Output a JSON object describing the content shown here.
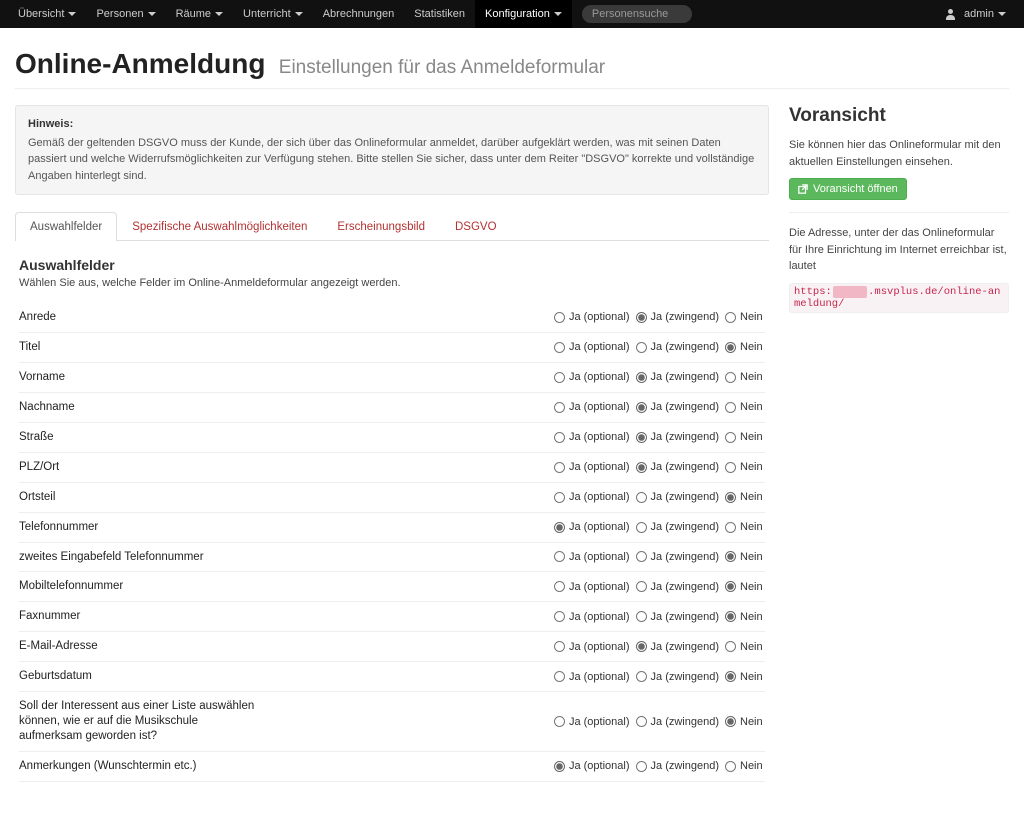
{
  "navbar": {
    "items": [
      {
        "label": "Übersicht",
        "caret": true
      },
      {
        "label": "Personen",
        "caret": true
      },
      {
        "label": "Räume",
        "caret": true
      },
      {
        "label": "Unterricht",
        "caret": true
      },
      {
        "label": "Abrechnungen",
        "caret": false
      },
      {
        "label": "Statistiken",
        "caret": false
      },
      {
        "label": "Konfiguration",
        "caret": true,
        "active": true
      }
    ],
    "search_placeholder": "Personensuche",
    "user_label": "admin"
  },
  "page": {
    "title": "Online-Anmeldung",
    "subtitle": "Einstellungen für das Anmeldeformular"
  },
  "hint": {
    "heading": "Hinweis:",
    "body": "Gemäß der geltenden DSGVO muss der Kunde, der sich über das Onlineformular anmeldet, darüber aufgeklärt werden, was mit seinen Daten passiert und welche Widerrufsmöglichkeiten zur Verfügung stehen. Bitte stellen Sie sicher, dass unter dem Reiter \"DSGVO\" korrekte und vollständige Angaben hinterlegt sind."
  },
  "tabs": [
    {
      "label": "Auswahlfelder",
      "active": true
    },
    {
      "label": "Spezifische Auswahlmöglichkeiten"
    },
    {
      "label": "Erscheinungsbild"
    },
    {
      "label": "DSGVO"
    }
  ],
  "section": {
    "title": "Auswahlfelder",
    "desc": "Wählen Sie aus, welche Felder im Online-Anmeldeformular angezeigt werden."
  },
  "option_labels": {
    "optional": "Ja (optional)",
    "required": "Ja (zwingend)",
    "no": "Nein"
  },
  "fields": [
    {
      "label": "Anrede",
      "selected": "required"
    },
    {
      "label": "Titel",
      "selected": "no"
    },
    {
      "label": "Vorname",
      "selected": "required"
    },
    {
      "label": "Nachname",
      "selected": "required"
    },
    {
      "label": "Straße",
      "selected": "required"
    },
    {
      "label": "PLZ/Ort",
      "selected": "required"
    },
    {
      "label": "Ortsteil",
      "selected": "no"
    },
    {
      "label": "Telefonnummer",
      "selected": "optional"
    },
    {
      "label": "zweites Eingabefeld Telefonnummer",
      "selected": "no"
    },
    {
      "label": "Mobiltelefonnummer",
      "selected": "no"
    },
    {
      "label": "Faxnummer",
      "selected": "no"
    },
    {
      "label": "E-Mail-Adresse",
      "selected": "required"
    },
    {
      "label": "Geburtsdatum",
      "selected": "no"
    },
    {
      "label": "Soll der Interessent aus einer Liste auswählen können, wie er auf die Musikschule aufmerksam geworden ist?",
      "selected": "no"
    },
    {
      "label": "Anmerkungen (Wunschtermin etc.)",
      "selected": "optional"
    }
  ],
  "preview": {
    "title": "Voransicht",
    "desc1": "Sie können hier das Onlineformular mit den aktuellen Einstellungen einsehen.",
    "button": "Voransicht öffnen",
    "desc2": "Die Adresse, unter der das Onlineformular für Ihre Einrichtung im Internet erreichbar ist, lautet",
    "url_pre": "https:",
    "url_post": ".msvplus.de/online-anmeldung/"
  }
}
